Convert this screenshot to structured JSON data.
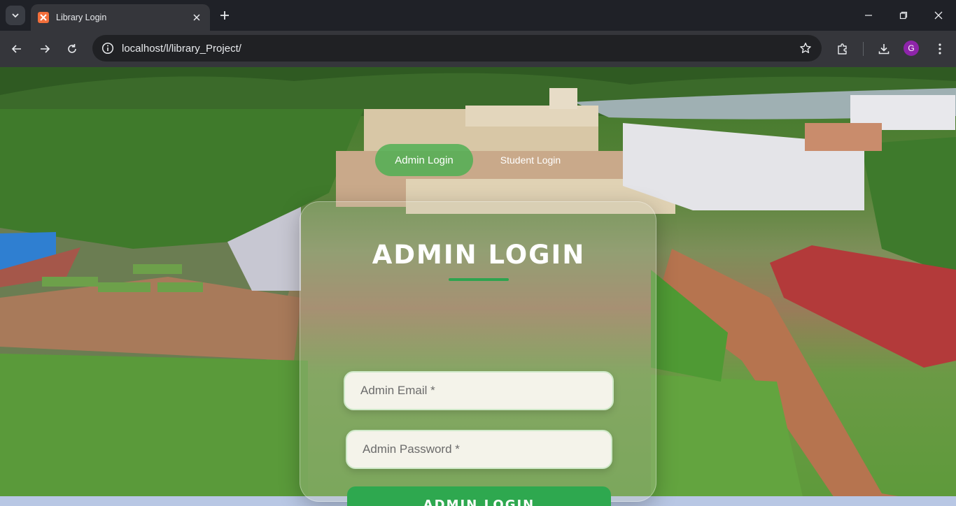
{
  "browser": {
    "tab_title": "Library Login",
    "url": "localhost/l/library_Project/",
    "profile_initial": "G"
  },
  "nav": {
    "admin_label": "Admin Login",
    "student_label": "Student Login"
  },
  "login_card": {
    "title": "ADMIN LOGIN",
    "email_placeholder": "Admin Email *",
    "email_value": "",
    "password_placeholder": "Admin Password *",
    "password_value": "",
    "submit_label": "ADMIN LOGIN"
  },
  "colors": {
    "accent_green": "#2ea84f",
    "chrome_dark": "#1f2127",
    "chrome_toolbar": "#35363b"
  }
}
